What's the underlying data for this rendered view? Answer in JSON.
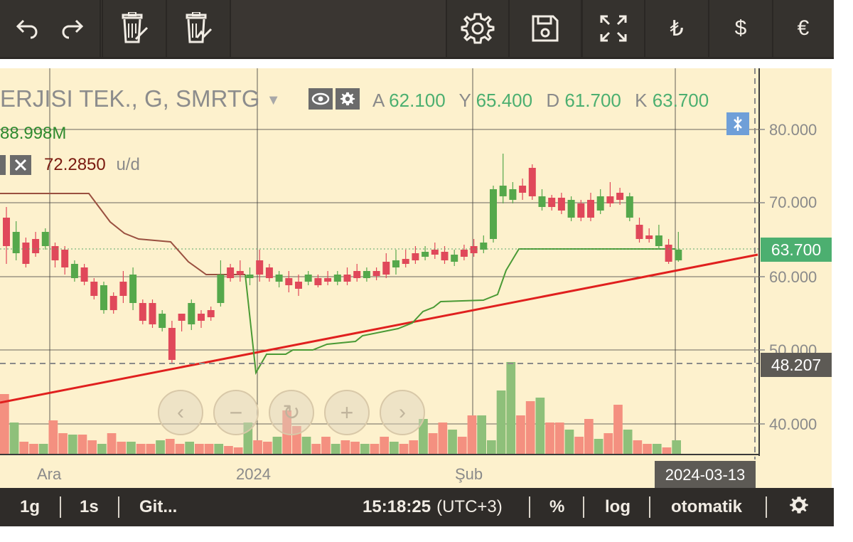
{
  "toolbar": {
    "undo": "undo-icon",
    "redo": "redo-icon",
    "delete_drawings": "trash-drawing-icon",
    "delete_indicators": "trash-indicator-icon",
    "settings": "gear-icon",
    "save": "save-icon",
    "fullscreen": "fullscreen-icon",
    "currency_try": "₺",
    "currency_usd": "$",
    "currency_eur": "€"
  },
  "legend": {
    "title": "ERJISI TEK., G, SMRTG",
    "open_label": "A",
    "open_value": "62.100",
    "high_label": "Y",
    "high_value": "65.400",
    "low_label": "D",
    "low_value": "61.700",
    "close_label": "K",
    "close_value": "63.700",
    "volume_value": "88.998M",
    "indicator_value": "72.2850",
    "indicator_unit": "u/d"
  },
  "price_axis": {
    "ticks": [
      "80.000",
      "70.000",
      "60.000",
      "50.000",
      "40.000"
    ],
    "current_price": "63.700",
    "crosshair_price": "48.207"
  },
  "time_axis": {
    "ticks": [
      "Ara",
      "2024",
      "Şub"
    ],
    "crosshair_date": "2024-03-13"
  },
  "bottombar": {
    "interval_1g": "1g",
    "interval_1s": "1s",
    "goto": "Git...",
    "clock": "15:18:25",
    "timezone": "(UTC+3)",
    "percent": "%",
    "log": "log",
    "auto": "otomatik"
  },
  "colors": {
    "up": "#55a84b",
    "down": "#e0485a",
    "trendline": "#e0201e",
    "support": "#4a9a35",
    "stop": "#9a5040",
    "bg": "#fdf1cd",
    "price_badge": "#4caf70"
  }
}
